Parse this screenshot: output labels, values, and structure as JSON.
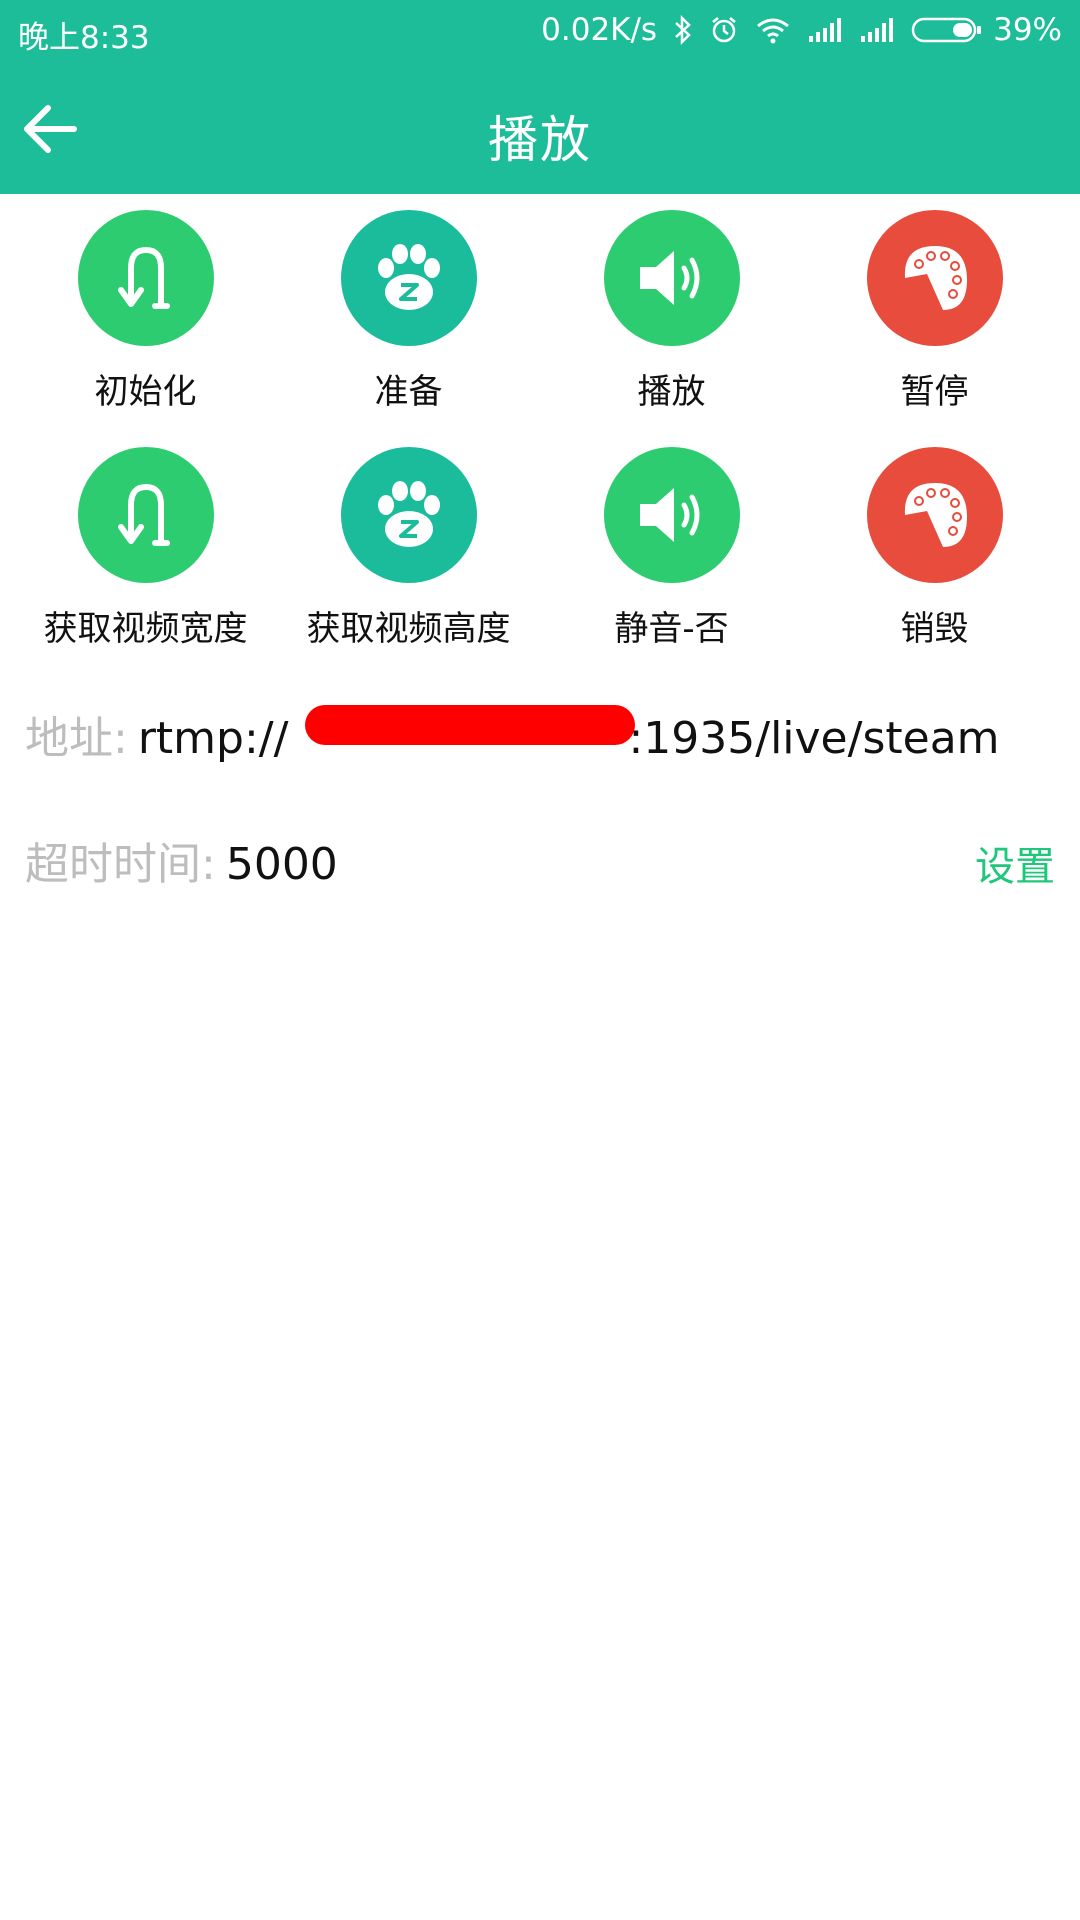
{
  "status_bar": {
    "time": "晚上8:33",
    "net_speed": "0.02K/s",
    "battery": "39%",
    "icons": [
      "bluetooth-icon",
      "alarm-icon",
      "wifi-icon",
      "signal-icon",
      "signal-icon",
      "battery-icon"
    ]
  },
  "appbar": {
    "title": "播放",
    "back_icon": "arrow-left-icon"
  },
  "colors": {
    "primary": "#1dbd9a",
    "green": "#2ecc71",
    "teal": "#1abc9c",
    "red": "#e74c3c",
    "accent_text": "#1fc77a",
    "muted": "#bdbdbd"
  },
  "actions": [
    {
      "label": "初始化",
      "icon": "u-turn-arrow-icon",
      "color": "#2ecc71"
    },
    {
      "label": "准备",
      "icon": "paw-icon",
      "color": "#1abc9c"
    },
    {
      "label": "播放",
      "icon": "speaker-icon",
      "color": "#2ecc71"
    },
    {
      "label": "暂停",
      "icon": "palette-icon",
      "color": "#e74c3c"
    },
    {
      "label": "获取视频宽度",
      "icon": "u-turn-arrow-icon",
      "color": "#2ecc71"
    },
    {
      "label": "获取视频高度",
      "icon": "paw-icon",
      "color": "#1abc9c"
    },
    {
      "label": "静音-否",
      "icon": "speaker-icon",
      "color": "#2ecc71"
    },
    {
      "label": "销毁",
      "icon": "palette-icon",
      "color": "#e74c3c"
    }
  ],
  "address": {
    "label": "地址:",
    "prefix": "rtmp://",
    "suffix": ":1935/live/steam"
  },
  "timeout": {
    "label": "超时时间:",
    "value": "5000",
    "action": "设置"
  }
}
